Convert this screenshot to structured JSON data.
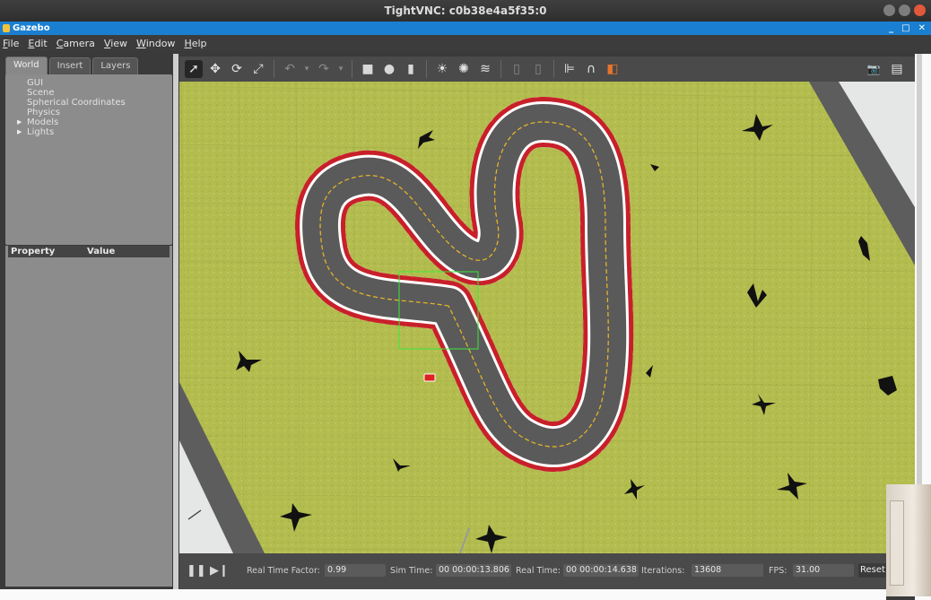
{
  "vnc": {
    "title": "TightVNC: c0b38e4a5f35:0"
  },
  "app": {
    "title": "Gazebo",
    "win_buttons": [
      "_",
      "□",
      "✕"
    ]
  },
  "menu": {
    "items": [
      "File",
      "Edit",
      "Camera",
      "View",
      "Window",
      "Help"
    ]
  },
  "left_panel": {
    "tabs": [
      "World",
      "Insert",
      "Layers"
    ],
    "active_tab": "World",
    "tree": [
      {
        "label": "GUI",
        "expandable": false
      },
      {
        "label": "Scene",
        "expandable": false
      },
      {
        "label": "Spherical Coordinates",
        "expandable": false
      },
      {
        "label": "Physics",
        "expandable": false
      },
      {
        "label": "Models",
        "expandable": true
      },
      {
        "label": "Lights",
        "expandable": true
      }
    ],
    "property_header": {
      "property": "Property",
      "value": "Value"
    }
  },
  "toolbar": {
    "tools": [
      {
        "name": "select-tool",
        "glyph": "➚",
        "active": true
      },
      {
        "name": "translate-tool",
        "glyph": "✥"
      },
      {
        "name": "rotate-tool",
        "glyph": "⟳"
      },
      {
        "name": "scale-tool",
        "glyph": "⤢"
      },
      {
        "sep": true
      },
      {
        "name": "undo-tool",
        "glyph": "↶",
        "dim": true
      },
      {
        "name": "undo-dropdown",
        "glyph": "▾",
        "dim": true
      },
      {
        "name": "redo-tool",
        "glyph": "↷",
        "dim": true
      },
      {
        "name": "redo-dropdown",
        "glyph": "▾",
        "dim": true
      },
      {
        "sep": true
      },
      {
        "name": "box-shape-tool",
        "glyph": "■"
      },
      {
        "name": "sphere-shape-tool",
        "glyph": "●"
      },
      {
        "name": "cylinder-shape-tool",
        "glyph": "▮"
      },
      {
        "sep": true
      },
      {
        "name": "point-light-tool",
        "glyph": "☀"
      },
      {
        "name": "spot-light-tool",
        "glyph": "✺"
      },
      {
        "name": "directional-light-tool",
        "glyph": "≋"
      },
      {
        "sep": true
      },
      {
        "name": "copy-tool",
        "glyph": "▯",
        "dim": true
      },
      {
        "name": "paste-tool",
        "glyph": "▯",
        "dim": true
      },
      {
        "sep": true
      },
      {
        "name": "align-tool",
        "glyph": "⊫"
      },
      {
        "name": "snap-tool",
        "glyph": "∩"
      },
      {
        "name": "view-angle-tool",
        "glyph": "◧",
        "accent": "#e8732a"
      }
    ],
    "right_tools": [
      {
        "name": "screenshot-tool",
        "glyph": "📷"
      },
      {
        "name": "log-tool",
        "glyph": "▤"
      }
    ]
  },
  "colors": {
    "grass": "#b3bd4f",
    "track": "#5a5a5a",
    "curb_red": "#c8202a",
    "curb_white": "#ffffff",
    "center_line": "#e2b32a",
    "selection": "#38e838"
  },
  "bottom_bar": {
    "play_icon": "pause",
    "step_icon": "step",
    "real_time_factor_label": "Real Time Factor:",
    "real_time_factor": "0.99",
    "sim_time_label": "Sim Time:",
    "sim_time": "00 00:00:13.806",
    "real_time_label": "Real Time:",
    "real_time": "00 00:00:14.638",
    "iterations_label": "Iterations:",
    "iterations": "13608",
    "fps_label": "FPS:",
    "fps": "31.00",
    "reset_label": "Reset"
  }
}
